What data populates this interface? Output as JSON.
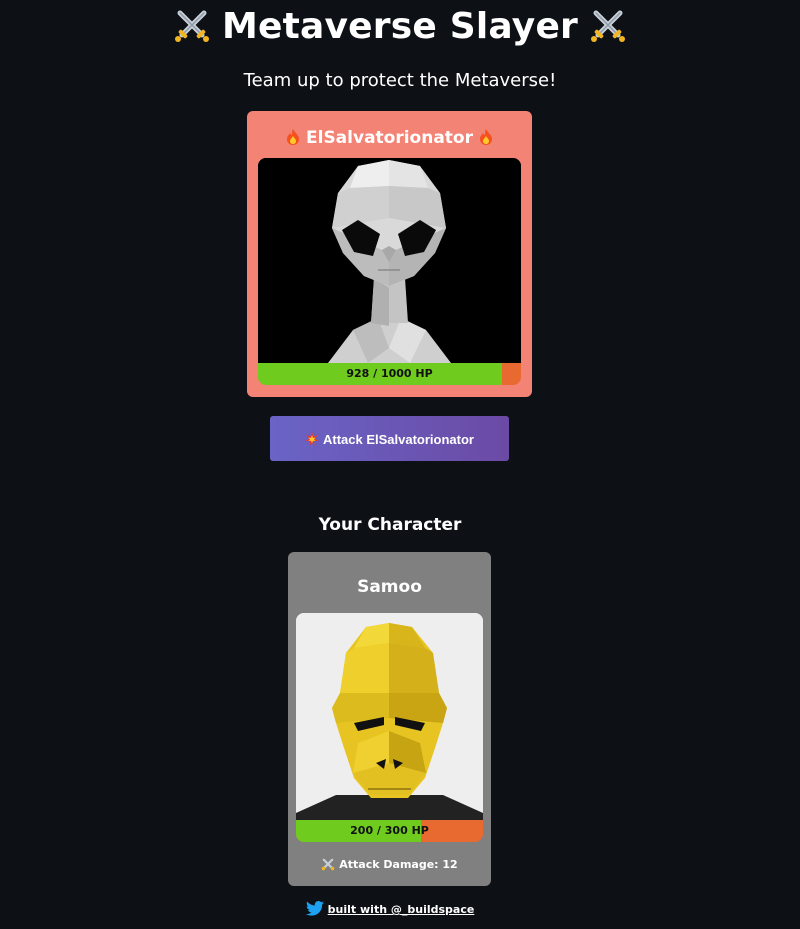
{
  "header": {
    "title": "Metaverse Slayer",
    "subtitle": "Team up to protect the Metaverse!"
  },
  "boss": {
    "name": "ElSalvatorionator",
    "hp_text": "928 / 1000 HP",
    "hp_fraction": 0.928
  },
  "attack_button": {
    "label": "Attack ElSalvatorionator"
  },
  "player": {
    "section_title": "Your Character",
    "name": "Samoo",
    "hp_text": "200 / 300 HP",
    "hp_fraction": 0.6667,
    "attack_damage": "Attack Damage: 12"
  },
  "footer": {
    "link_text": "built with @_buildspace"
  },
  "colors": {
    "background": "#0d1116",
    "boss_card": "#f38375",
    "player_card": "#808080",
    "hp_fill": "#6fcc1f",
    "hp_empty": "#e86a31",
    "button_start": "#6a64c6",
    "button_end": "#6b4aa5"
  },
  "icons": [
    "crossed-swords-icon",
    "fire-icon",
    "collision-icon",
    "twitter-bird-icon"
  ]
}
